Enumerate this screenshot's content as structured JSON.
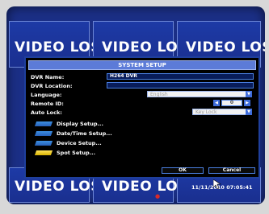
{
  "video_tiles": [
    {
      "label": "VIDEO LOSS"
    },
    {
      "label": "VIDEO LOSS"
    },
    {
      "label": "VIDEO LOSS"
    },
    {
      "label": "VIDEO LOSS"
    },
    {
      "label": "VIDEO LOSS"
    }
  ],
  "dialog": {
    "title": "SYSTEM SETUP",
    "fields": {
      "dvr_name_label": "DVR Name:",
      "dvr_name_value": "H264 DVR",
      "dvr_location_label": "DVR Location:",
      "dvr_location_value": "",
      "language_label": "Language:",
      "language_value": "English",
      "remote_id_label": "Remote ID:",
      "remote_id_value": "0",
      "auto_lock_label": "Auto Lock:",
      "auto_lock_value": "Key Lock"
    },
    "menu_items": [
      {
        "label": "Display Setup..."
      },
      {
        "label": "Date/Time Setup..."
      },
      {
        "label": "Device Setup..."
      },
      {
        "label": "Spot Setup..."
      }
    ],
    "ok_label": "OK",
    "cancel_label": "Cancel"
  },
  "status": {
    "datetime": "11/11/2010 07:05:41"
  },
  "colors": {
    "screen_bg": "#1b2f86",
    "title_bar": "#5c7bd8",
    "accent": "#3f6ddb",
    "spot_icon": "#ffe35b"
  }
}
